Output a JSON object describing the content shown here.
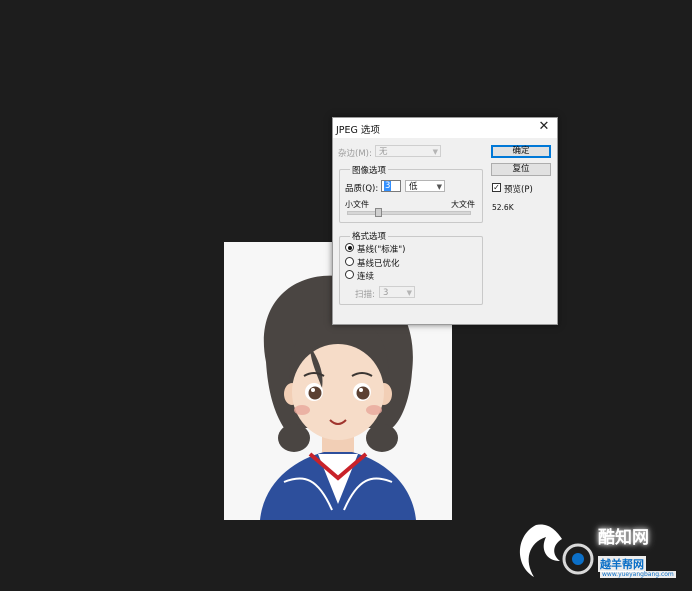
{
  "dialog": {
    "title": "JPEG 选项",
    "matte": {
      "label": "杂边(M):",
      "value": "无"
    },
    "buttons": {
      "ok": "确定",
      "reset": "复位"
    },
    "preview": {
      "label": "预览(P)",
      "checked": true
    },
    "file_size": "52.6K",
    "image_options": {
      "title": "图像选项",
      "quality_label": "品质(Q):",
      "quality_value": "3",
      "quality_preset": "低",
      "small_file": "小文件",
      "large_file": "大文件",
      "slider_level_fraction": 0.25
    },
    "format_options": {
      "title": "格式选项",
      "baseline_standard": "基线(\"标准\")",
      "baseline_optimized": "基线已优化",
      "progressive": "连续",
      "scans_label": "扫描:",
      "scans_value": "3",
      "selected": "baseline_standard"
    }
  },
  "watermark": {
    "line1": "酷知网",
    "line2": "越羊帮网",
    "url": "www.yueyangbang.com"
  },
  "colors": {
    "workspace": "#1d1d1d",
    "hair": "#4a4542",
    "skin": "#f6dcc8",
    "uniform": "#2d4f9c",
    "collar_red": "#c8222a"
  }
}
